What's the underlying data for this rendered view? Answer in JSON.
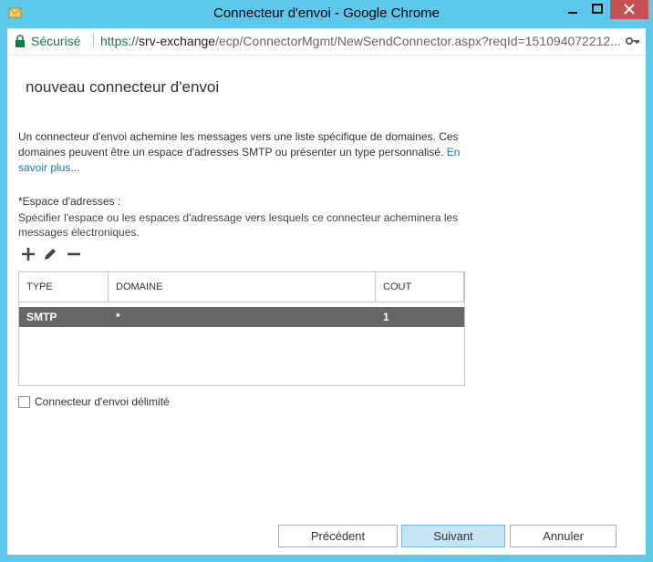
{
  "window": {
    "title": "Connecteur d'envoi - Google Chrome"
  },
  "addressbar": {
    "secure_label": "Sécurisé",
    "url_scheme": "https://",
    "url_host": "srv-exchange",
    "url_path": "/ecp/ConnectorMgmt/NewSendConnector.aspx?reqId=151094072212..."
  },
  "page": {
    "heading": "nouveau connecteur d'envoi",
    "description": "Un connecteur d'envoi achemine les messages vers une liste spécifique de domaines. Ces domaines peuvent être un espace d'adresses SMTP ou présenter un type personnalisé.",
    "learn_more": "En savoir plus...",
    "address_space_label": "*Espace d'adresses :",
    "address_space_help": "Spécifier l'espace ou les espaces d'adressage vers lesquels ce connecteur acheminera les messages électroniques."
  },
  "table": {
    "columns": [
      "TYPE",
      "DOMAINE",
      "COUT"
    ],
    "rows": [
      {
        "type": "SMTP",
        "domain": "*",
        "cost": "1"
      }
    ]
  },
  "checkbox": {
    "label": "Connecteur d'envoi délimité",
    "checked": false
  },
  "buttons": {
    "previous": "Précédent",
    "next": "Suivant",
    "cancel": "Annuler"
  },
  "icons": [
    "window-app-icon",
    "lock-icon",
    "key-icon",
    "add-icon",
    "edit-icon",
    "remove-icon"
  ],
  "colors": {
    "window_frame": "#5bc8ec",
    "close_button": "#c75050",
    "secure_green": "#0b8043",
    "selected_row": "#666666",
    "primary_button": "#c7e3f6",
    "link": "#1a73b8"
  }
}
